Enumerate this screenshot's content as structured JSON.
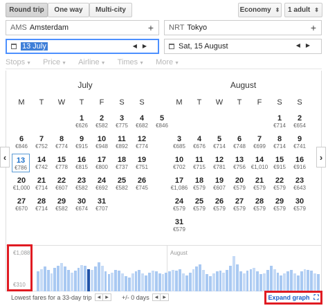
{
  "trip_types": [
    "Round trip",
    "One way",
    "Multi-city"
  ],
  "cabin_class": "Economy",
  "passengers": "1 adult",
  "origin": {
    "code": "AMS",
    "city": "Amsterdam"
  },
  "destination": {
    "code": "NRT",
    "city": "Tokyo"
  },
  "depart_date": "13 July",
  "return_date": "Sat, 15 August",
  "filters": [
    "Stops",
    "Price",
    "Airline",
    "Times",
    "More"
  ],
  "weekdays": [
    "M",
    "T",
    "W",
    "T",
    "F",
    "S",
    "S"
  ],
  "months": [
    {
      "name": "July",
      "weeks": [
        [
          null,
          null,
          null,
          {
            "d": "1",
            "p": "€626"
          },
          {
            "d": "2",
            "p": "€582"
          },
          {
            "d": "3",
            "p": "€775"
          },
          {
            "d": "4",
            "p": "€682"
          },
          {
            "d": "5",
            "p": "€846"
          }
        ],
        [
          {
            "d": "6",
            "p": "€846"
          },
          {
            "d": "7",
            "p": "€752"
          },
          {
            "d": "8",
            "p": "€774"
          },
          {
            "d": "9",
            "p": "€915"
          },
          {
            "d": "10",
            "p": "€948"
          },
          {
            "d": "11",
            "p": "€892"
          },
          {
            "d": "12",
            "p": "€774"
          }
        ],
        [
          {
            "d": "13",
            "p": "€786"
          },
          {
            "d": "14",
            "p": "€742"
          },
          {
            "d": "15",
            "p": "€778"
          },
          {
            "d": "16",
            "p": "€815"
          },
          {
            "d": "17",
            "p": "€800"
          },
          {
            "d": "18",
            "p": "€737"
          },
          {
            "d": "19",
            "p": "€751"
          }
        ],
        [
          {
            "d": "20",
            "p": "€1,000"
          },
          {
            "d": "21",
            "p": "€714"
          },
          {
            "d": "22",
            "p": "€607"
          },
          {
            "d": "23",
            "p": "€582"
          },
          {
            "d": "24",
            "p": "€692"
          },
          {
            "d": "25",
            "p": "€582"
          },
          {
            "d": "26",
            "p": "€745"
          }
        ],
        [
          {
            "d": "27",
            "p": "€670"
          },
          {
            "d": "28",
            "p": "€714"
          },
          {
            "d": "29",
            "p": "€582"
          },
          {
            "d": "30",
            "p": "€674"
          },
          {
            "d": "31",
            "p": "€707"
          },
          null,
          null
        ]
      ]
    },
    {
      "name": "August",
      "weeks": [
        [
          null,
          null,
          null,
          null,
          null,
          {
            "d": "1",
            "p": "€714"
          },
          {
            "d": "2",
            "p": "€654"
          }
        ],
        [
          {
            "d": "3",
            "p": "€685"
          },
          {
            "d": "4",
            "p": "€676"
          },
          {
            "d": "5",
            "p": "€714"
          },
          {
            "d": "6",
            "p": "€748"
          },
          {
            "d": "7",
            "p": "€699"
          },
          {
            "d": "8",
            "p": "€714"
          },
          {
            "d": "9",
            "p": "€741"
          }
        ],
        [
          {
            "d": "10",
            "p": "€702"
          },
          {
            "d": "11",
            "p": "€715"
          },
          {
            "d": "12",
            "p": "€781"
          },
          {
            "d": "13",
            "p": "€756"
          },
          {
            "d": "14",
            "p": "€1,010"
          },
          {
            "d": "15",
            "p": "€915"
          },
          {
            "d": "16",
            "p": "€916"
          }
        ],
        [
          {
            "d": "17",
            "p": "€1,086"
          },
          {
            "d": "18",
            "p": "€579"
          },
          {
            "d": "19",
            "p": "€607"
          },
          {
            "d": "20",
            "p": "€579"
          },
          {
            "d": "21",
            "p": "€579"
          },
          {
            "d": "22",
            "p": "€579"
          },
          {
            "d": "23",
            "p": "€643"
          }
        ],
        [
          {
            "d": "24",
            "p": "€579"
          },
          {
            "d": "25",
            "p": "€579"
          },
          {
            "d": "26",
            "p": "€579"
          },
          {
            "d": "27",
            "p": "€579"
          },
          {
            "d": "28",
            "p": "€579"
          },
          {
            "d": "29",
            "p": "€579"
          },
          {
            "d": "30",
            "p": "€579"
          }
        ],
        [
          {
            "d": "31",
            "p": "€579"
          },
          null,
          null,
          null,
          null,
          null,
          null
        ]
      ]
    }
  ],
  "selected_day": "13",
  "graph": {
    "max_label": "€1,088",
    "min_label": "€310",
    "month_marker": "August",
    "bar_values": [
      0.55,
      0.62,
      0.7,
      0.6,
      0.5,
      0.65,
      0.72,
      0.78,
      0.7,
      0.6,
      0.52,
      0.58,
      0.66,
      0.74,
      0.72,
      0.62,
      0.6,
      0.7,
      0.8,
      0.72,
      0.55,
      0.48,
      0.52,
      0.6,
      0.58,
      0.5,
      0.42,
      0.38,
      0.5,
      0.56,
      0.6,
      0.5,
      0.45,
      0.52,
      0.58,
      0.55,
      0.5,
      0.48,
      0.52,
      0.55,
      0.6,
      0.58,
      0.62,
      0.5,
      0.45,
      0.52,
      0.62,
      0.7,
      0.75,
      0.6,
      0.48,
      0.42,
      0.5,
      0.55,
      0.58,
      0.52,
      0.6,
      0.72,
      0.98,
      0.75,
      0.55,
      0.5,
      0.58,
      0.62,
      0.66,
      0.55,
      0.48,
      0.5,
      0.6,
      0.72,
      0.62,
      0.52,
      0.45,
      0.5,
      0.55,
      0.6,
      0.5,
      0.45,
      0.55,
      0.62,
      0.6,
      0.58,
      0.5,
      0.48
    ],
    "selected_bar_index": 15
  },
  "footer": {
    "lowest_fares_label": "Lowest fares for a 33-day trip",
    "days_label": "+/- 0 days",
    "expand_label": "Expand graph"
  },
  "colors": {
    "accent": "#1a6fc9",
    "highlight_box": "#e01b22",
    "bar": "#a9c9f2",
    "bar_selected": "#2153a8"
  }
}
